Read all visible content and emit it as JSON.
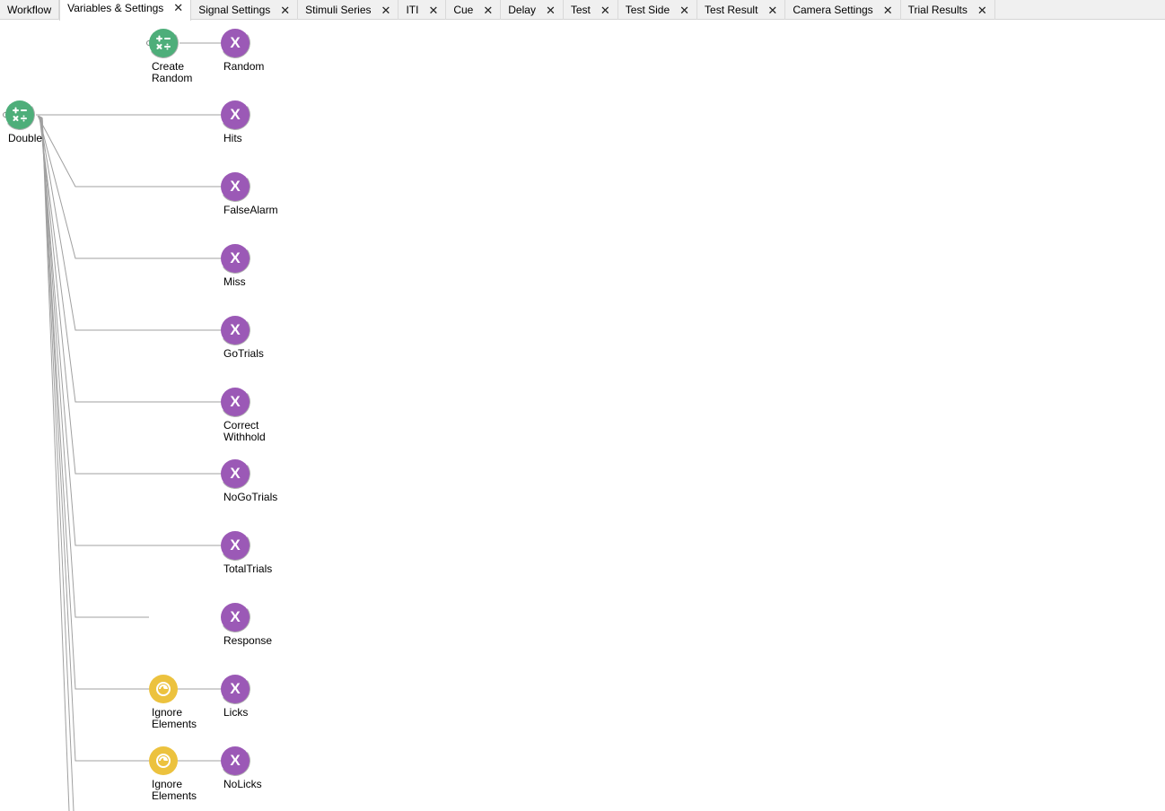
{
  "tabs": [
    {
      "label": "Workflow",
      "closable": false,
      "active": false
    },
    {
      "label": "Variables & Settings",
      "closable": true,
      "active": true
    },
    {
      "label": "Signal Settings",
      "closable": true,
      "active": false
    },
    {
      "label": "Stimuli Series",
      "closable": true,
      "active": false
    },
    {
      "label": "ITI",
      "closable": true,
      "active": false
    },
    {
      "label": "Cue",
      "closable": true,
      "active": false
    },
    {
      "label": "Delay",
      "closable": true,
      "active": false
    },
    {
      "label": "Test",
      "closable": true,
      "active": false
    },
    {
      "label": "Test Side",
      "closable": true,
      "active": false
    },
    {
      "label": "Test Result",
      "closable": true,
      "active": false
    },
    {
      "label": "Camera Settings",
      "closable": true,
      "active": false
    },
    {
      "label": "Trial Results",
      "closable": true,
      "active": false
    }
  ],
  "close_glyph": "✕",
  "nodes": {
    "create_random": {
      "label": "Create\nRandom",
      "icon": "calculator-icon"
    },
    "double": {
      "label": "Double",
      "icon": "calculator-icon"
    },
    "variables": [
      {
        "id": "random",
        "symbol": "X",
        "label": "Random"
      },
      {
        "id": "hits",
        "symbol": "X",
        "label": "Hits"
      },
      {
        "id": "falsealarm",
        "symbol": "X",
        "label": "FalseAlarm"
      },
      {
        "id": "miss",
        "symbol": "X",
        "label": "Miss"
      },
      {
        "id": "gotrials",
        "symbol": "X",
        "label": "GoTrials"
      },
      {
        "id": "correct-withhold",
        "symbol": "X",
        "label": "Correct\nWithhold"
      },
      {
        "id": "nogotrials",
        "symbol": "X",
        "label": "NoGoTrials"
      },
      {
        "id": "totaltrials",
        "symbol": "X",
        "label": "TotalTrials"
      },
      {
        "id": "response",
        "symbol": "X",
        "label": "Response"
      },
      {
        "id": "licks",
        "symbol": "X",
        "label": "Licks"
      },
      {
        "id": "nolicks",
        "symbol": "X",
        "label": "NoLicks"
      }
    ],
    "ignore_elements": [
      {
        "label": "Ignore\nElements",
        "icon": "ignore-elements-icon"
      },
      {
        "label": "Ignore\nElements",
        "icon": "ignore-elements-icon"
      }
    ]
  },
  "colors": {
    "variable": "#9b59b6",
    "calculator": "#4eae7a",
    "ignore": "#ecc23e",
    "wire": "#a0a0a0"
  }
}
